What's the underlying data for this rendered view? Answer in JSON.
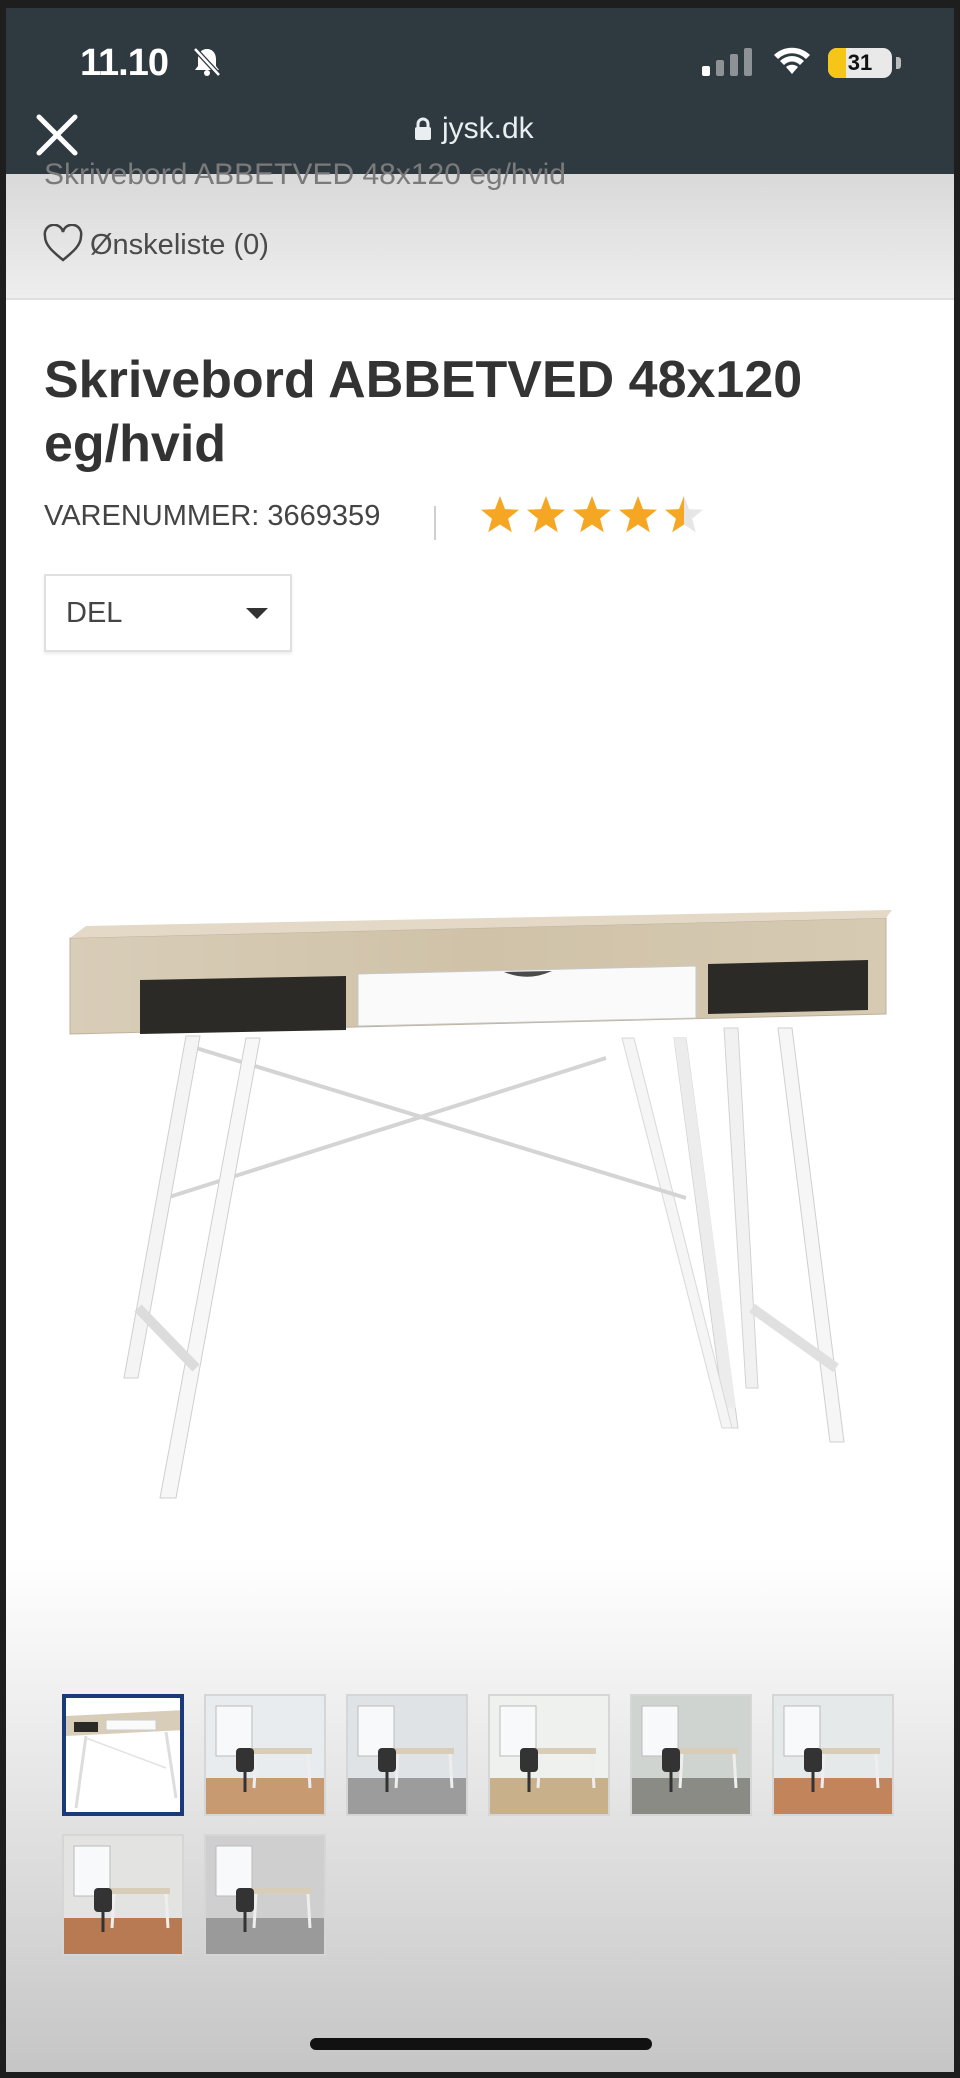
{
  "status_bar": {
    "time": "11.10",
    "battery": "31"
  },
  "browser": {
    "url": "jysk.dk"
  },
  "breadcrumb_cut": "Skrivebord ABBETVED 48x120 eg/hvid",
  "wishlist": {
    "label": "Ønskeliste (0)"
  },
  "product": {
    "title": "Skrivebord ABBETVED 48x120 eg/hvid",
    "item_number": "VARENUMMER: 3669359",
    "rating": 4.5,
    "rating_max": 5,
    "share_label": "DEL"
  },
  "colors": {
    "star": "#f5a623",
    "active_thumb_border": "#1b3a7a",
    "top_bar": "#2f3a40"
  },
  "icons": {
    "close": "close-icon",
    "lock": "lock-icon",
    "heart": "heart-icon",
    "bell": "bell-slash-icon",
    "caret": "chevron-down-icon"
  },
  "thumbnails": [
    {
      "name": "desk-product-only",
      "active": true
    },
    {
      "name": "desk-room-scene-1",
      "active": false
    },
    {
      "name": "desk-room-scene-2",
      "active": false
    },
    {
      "name": "desk-room-scene-3",
      "active": false
    },
    {
      "name": "desk-room-scene-4",
      "active": false
    },
    {
      "name": "desk-room-scene-5",
      "active": false
    },
    {
      "name": "desk-room-scene-6",
      "active": false
    },
    {
      "name": "desk-room-scene-7",
      "active": false
    }
  ]
}
